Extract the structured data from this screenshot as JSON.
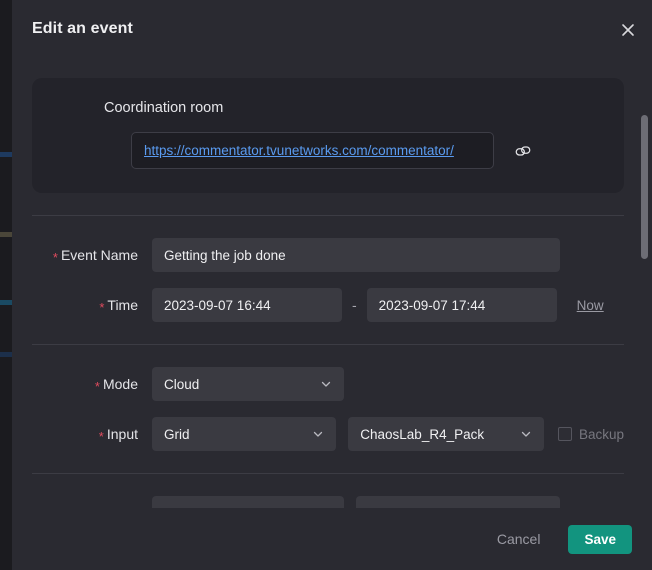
{
  "dialog": {
    "title": "Edit an event",
    "close_icon": "close-icon"
  },
  "coordination": {
    "title": "Coordination room",
    "url": "https://commentator.tvunetworks.com/commentator/",
    "copy_icon": "copy-link-icon"
  },
  "form": {
    "event_name": {
      "label": "Event Name",
      "required_mark": "*",
      "value": "Getting the job done",
      "placeholder": "Event Name"
    },
    "time": {
      "label": "Time",
      "required_mark": "*",
      "start": "2023-09-07 16:44",
      "end": "2023-09-07 17:44",
      "separator": "-",
      "now_label": "Now"
    },
    "mode": {
      "label": "Mode",
      "required_mark": "*",
      "value": "Cloud"
    },
    "input": {
      "label": "Input",
      "required_mark": "*",
      "type_value": "Grid",
      "source_value": "ChaosLab_R4_Pack",
      "backup_label": "Backup",
      "backup_checked": false
    }
  },
  "footer": {
    "cancel_label": "Cancel",
    "save_label": "Save"
  },
  "colors": {
    "dialog_bg": "#2a2a31",
    "card_bg": "#23232a",
    "input_bg": "#3a3a41",
    "accent_save": "#12947f",
    "link_blue": "#5a9bf0",
    "required_red": "#e04b5e",
    "divider": "#3c3c44"
  }
}
